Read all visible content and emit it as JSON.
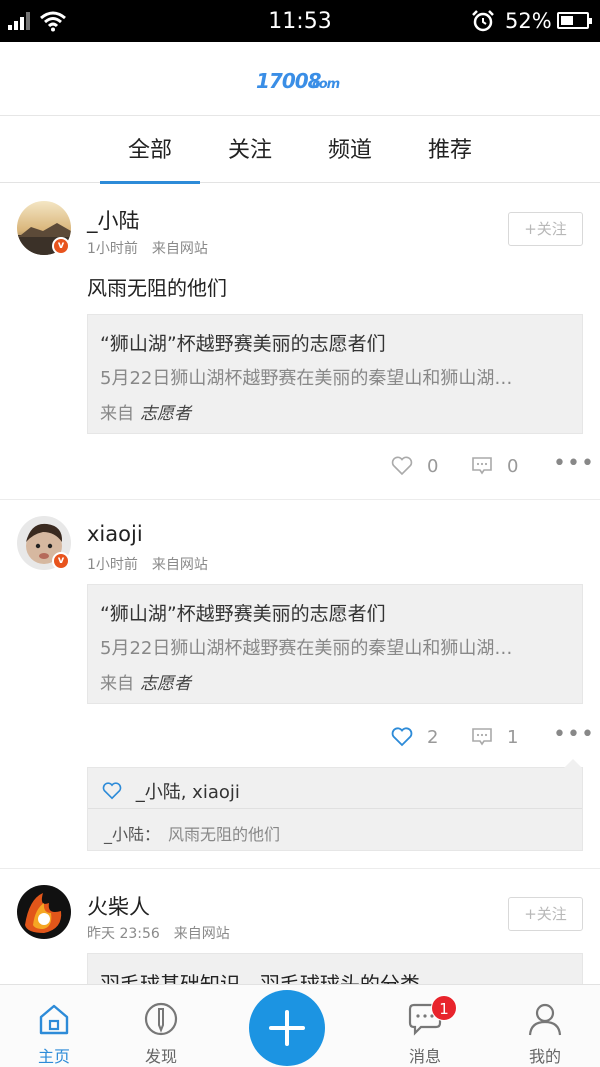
{
  "status_bar": {
    "time": "11:53",
    "battery_percent": "52%",
    "battery_level": 0.52
  },
  "header": {
    "logo_text": "17008com"
  },
  "tabs": [
    {
      "label": "全部",
      "active": true
    },
    {
      "label": "关注",
      "active": false
    },
    {
      "label": "频道",
      "active": false
    },
    {
      "label": "推荐",
      "active": false
    }
  ],
  "posts": [
    {
      "username": "_小陆",
      "time": "1小时前",
      "source": "来自网站",
      "follow_label": "+关注",
      "text": "风雨无阻的他们",
      "card": {
        "title": "“狮山湖”杯越野赛美丽的志愿者们",
        "desc": "5月22日狮山湖杯越野赛在美丽的秦望山和狮山湖…",
        "from_label": "来自",
        "from_name": "志愿者"
      },
      "likes": "0",
      "comments": "0"
    },
    {
      "username": "xiaoji",
      "time": "1小时前",
      "source": "来自网站",
      "card": {
        "title": "“狮山湖”杯越野赛美丽的志愿者们",
        "desc": "5月22日狮山湖杯越野赛在美丽的秦望山和狮山湖…",
        "from_label": "来自",
        "from_name": "志愿者"
      },
      "likes": "2",
      "comments": "1",
      "liked_by": "_小陆, xiaoji",
      "comment": {
        "author": "_小陆：",
        "text": "风雨无阻的他们"
      }
    },
    {
      "username": "火柴人",
      "time": "昨天 23:56",
      "source": "来自网站",
      "follow_label": "+关注",
      "card": {
        "title": "羽毛球基础知识 - 羽毛球球头的分类"
      }
    }
  ],
  "bottom_nav": [
    {
      "label": "主页",
      "icon": "home-icon",
      "active": true
    },
    {
      "label": "发现",
      "icon": "discover-icon",
      "active": false
    },
    {
      "label": "消息",
      "icon": "message-icon",
      "active": false,
      "badge": "1"
    },
    {
      "label": "我的",
      "icon": "profile-icon",
      "active": false
    }
  ],
  "colors": {
    "accent": "#2d8bd8",
    "fab": "#1c94e2",
    "badge": "#e8242c"
  }
}
